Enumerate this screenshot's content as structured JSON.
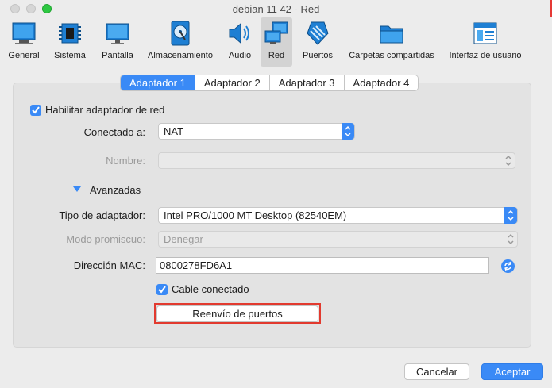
{
  "window": {
    "title": "debian 11 42 - Red"
  },
  "toolbar": {
    "items": [
      {
        "label": "General",
        "icon": "general-icon"
      },
      {
        "label": "Sistema",
        "icon": "chip-icon"
      },
      {
        "label": "Pantalla",
        "icon": "monitor-icon"
      },
      {
        "label": "Almacenamiento",
        "icon": "storage-icon"
      },
      {
        "label": "Audio",
        "icon": "speaker-icon"
      },
      {
        "label": "Red",
        "icon": "network-icon"
      },
      {
        "label": "Puertos",
        "icon": "ports-icon"
      },
      {
        "label": "Carpetas compartidas",
        "icon": "folder-icon"
      },
      {
        "label": "Interfaz de usuario",
        "icon": "window-icon"
      }
    ],
    "active": "Red"
  },
  "tabs": [
    "Adaptador 1",
    "Adaptador 2",
    "Adaptador 3",
    "Adaptador 4"
  ],
  "form": {
    "enable_adapter": "Habilitar adaptador de red",
    "attached_label": "Conectado a:",
    "attached_value": "NAT",
    "name_label": "Nombre:",
    "name_value": "",
    "advanced": "Avanzadas",
    "adapter_type_label": "Tipo de adaptador:",
    "adapter_type_value": "Intel PRO/1000 MT Desktop (82540EM)",
    "promisc_label": "Modo promiscuo:",
    "promisc_value": "Denegar",
    "mac_label": "Dirección MAC:",
    "mac_value": "0800278FD6A1",
    "cable_connected": "Cable conectado",
    "port_forwarding": "Reenvío de puertos"
  },
  "footer": {
    "cancel": "Cancelar",
    "accept": "Aceptar"
  },
  "colors": {
    "accent": "#3a8af6",
    "highlight": "#e23a2f"
  }
}
